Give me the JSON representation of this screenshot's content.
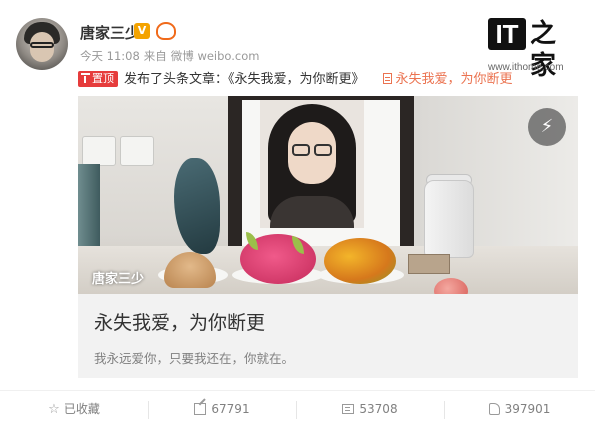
{
  "post": {
    "author": "唐家三少",
    "verified_badge": "V",
    "vip_badge": "VIP",
    "time": "今天 11:08",
    "source_prefix": "来自",
    "source": "微博 weibo.com",
    "pin_label": "置顶",
    "headline_text": "发布了头条文章：《永失我爱，为你断更》",
    "article_link": "永失我爱，为你断更"
  },
  "logo": {
    "it": "IT",
    "zh": "之家",
    "url": "www.ithome.com"
  },
  "card": {
    "watermark": "唐家三少",
    "title": "永失我爱，为你断更",
    "description": "我永远爱你，只要我还在，你就在。",
    "share_icon": "lightning-icon"
  },
  "toolbar": {
    "favorite_label": "已收藏",
    "repost_count": "67791",
    "comment_count": "53708",
    "like_count": "397901"
  },
  "colors": {
    "accent": "#eb7350",
    "pin": "#e63c3c",
    "badge_v": "#f4a300"
  }
}
